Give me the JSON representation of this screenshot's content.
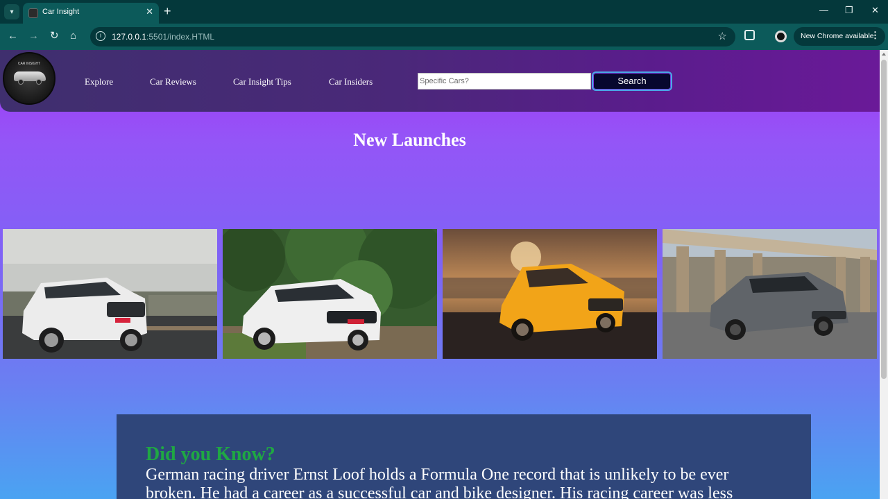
{
  "browser": {
    "tab_title": "Car Insight",
    "new_tab_icon": "plus-icon",
    "url_host": "127.0.0.1",
    "url_path": ":5501/index.HTML",
    "new_chrome_label": "New Chrome available",
    "window_controls": [
      "minimize-icon",
      "restore-icon",
      "close-icon"
    ]
  },
  "site": {
    "logo_text": "CAR INSIGHT",
    "nav": [
      {
        "label": "Explore"
      },
      {
        "label": "Car Reviews"
      },
      {
        "label": "Car Insight Tips"
      },
      {
        "label": "Car Insiders"
      }
    ],
    "search": {
      "placeholder": "Specific Cars?",
      "button_label": "Search"
    },
    "new_launches": {
      "title": "New Launches",
      "cars": [
        {
          "name": "white-suv-photo",
          "color": "#e8e8e8"
        },
        {
          "name": "white-compact-suv-photo",
          "color": "#f2f2f2"
        },
        {
          "name": "orange-suv-photo",
          "color": "#f0a020"
        },
        {
          "name": "grey-ev-crossover-photo",
          "color": "#6a6e73"
        }
      ]
    },
    "did_you_know": {
      "heading": "Did you Know?",
      "body": "German racing driver Ernst Loof holds a Formula One record that is unlikely to be ever broken. He had a career as a successful car and bike designer. His racing career was less"
    }
  },
  "colors": {
    "header_bg": "#4a2879",
    "search_button_bg": "#07072e",
    "dyk_heading": "#1fa843",
    "dyk_panel": "#2f467a"
  }
}
